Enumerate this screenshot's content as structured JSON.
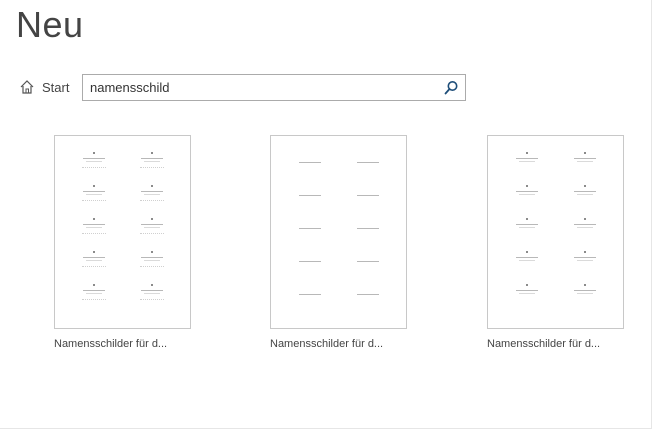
{
  "header": {
    "title": "Neu"
  },
  "nav": {
    "start_label": "Start",
    "home_icon": "home-icon"
  },
  "search": {
    "value": "namensschild",
    "icon": "search-icon"
  },
  "templates": [
    {
      "caption": "Namensschilder für d..."
    },
    {
      "caption": "Namensschilder für d..."
    },
    {
      "caption": "Namensschilder für d..."
    }
  ],
  "colors": {
    "text": "#444444",
    "border": "#c8c8c8",
    "search_icon": "#1e4e79"
  }
}
